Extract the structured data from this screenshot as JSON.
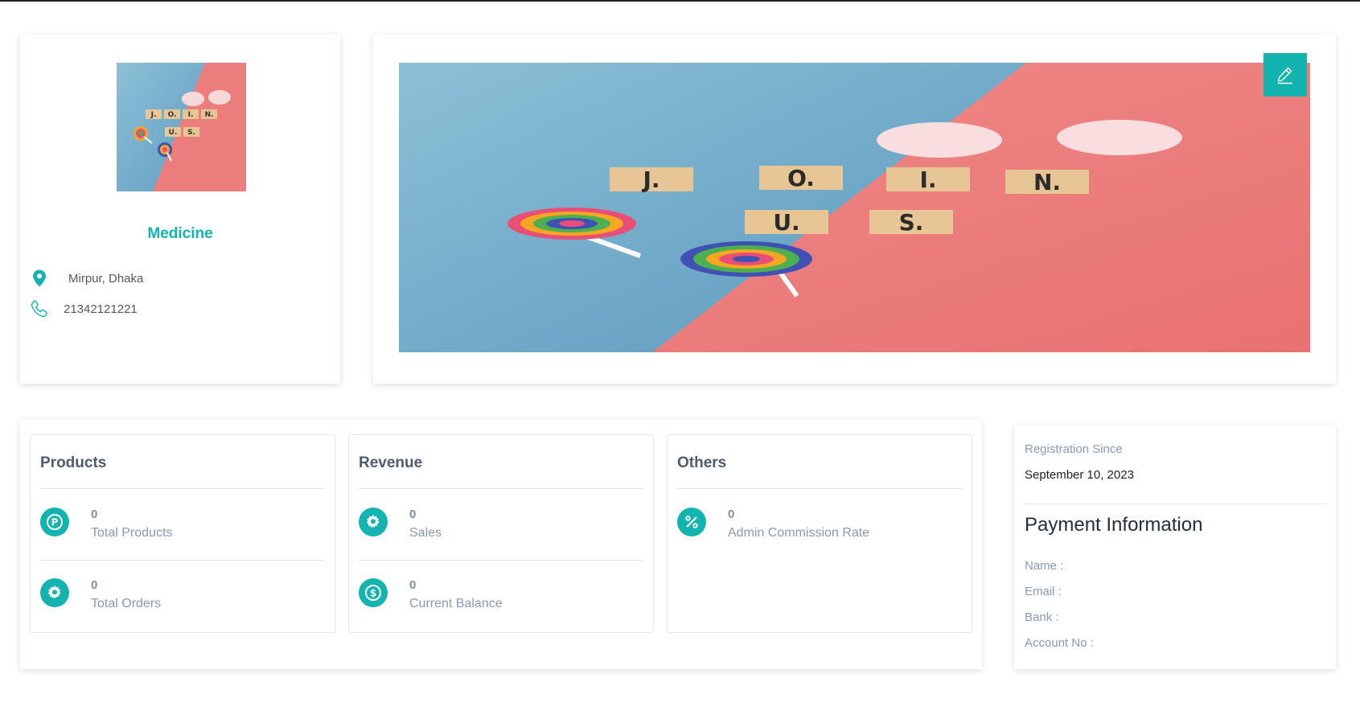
{
  "profile": {
    "store_name": "Medicine",
    "location": "Mirpur, Dhaka",
    "phone": "21342121221",
    "image_tiles": {
      "row1": [
        "J.",
        "O.",
        "I.",
        "N."
      ],
      "row2": [
        "U.",
        "S."
      ]
    }
  },
  "stats": {
    "products": {
      "title": "Products",
      "items": [
        {
          "value": "0",
          "label": "Total Products",
          "icon": "p-circle-icon"
        },
        {
          "value": "0",
          "label": "Total Orders",
          "icon": "gear-icon"
        }
      ]
    },
    "revenue": {
      "title": "Revenue",
      "items": [
        {
          "value": "0",
          "label": "Sales",
          "icon": "gear-icon"
        },
        {
          "value": "0",
          "label": "Current Balance",
          "icon": "dollar-circle-icon"
        }
      ]
    },
    "others": {
      "title": "Others",
      "items": [
        {
          "value": "0",
          "label": "Admin Commission Rate",
          "icon": "percent-icon"
        }
      ]
    }
  },
  "info": {
    "registration_label": "Registration Since",
    "registration_date": "September 10, 2023",
    "payment_title": "Payment Information",
    "fields": [
      "Name :",
      "Email :",
      "Bank :",
      "Account No :"
    ]
  },
  "colors": {
    "accent": "#13b3b0",
    "image_blue": "#7fb3cf",
    "image_pink": "#ea7b7b"
  }
}
